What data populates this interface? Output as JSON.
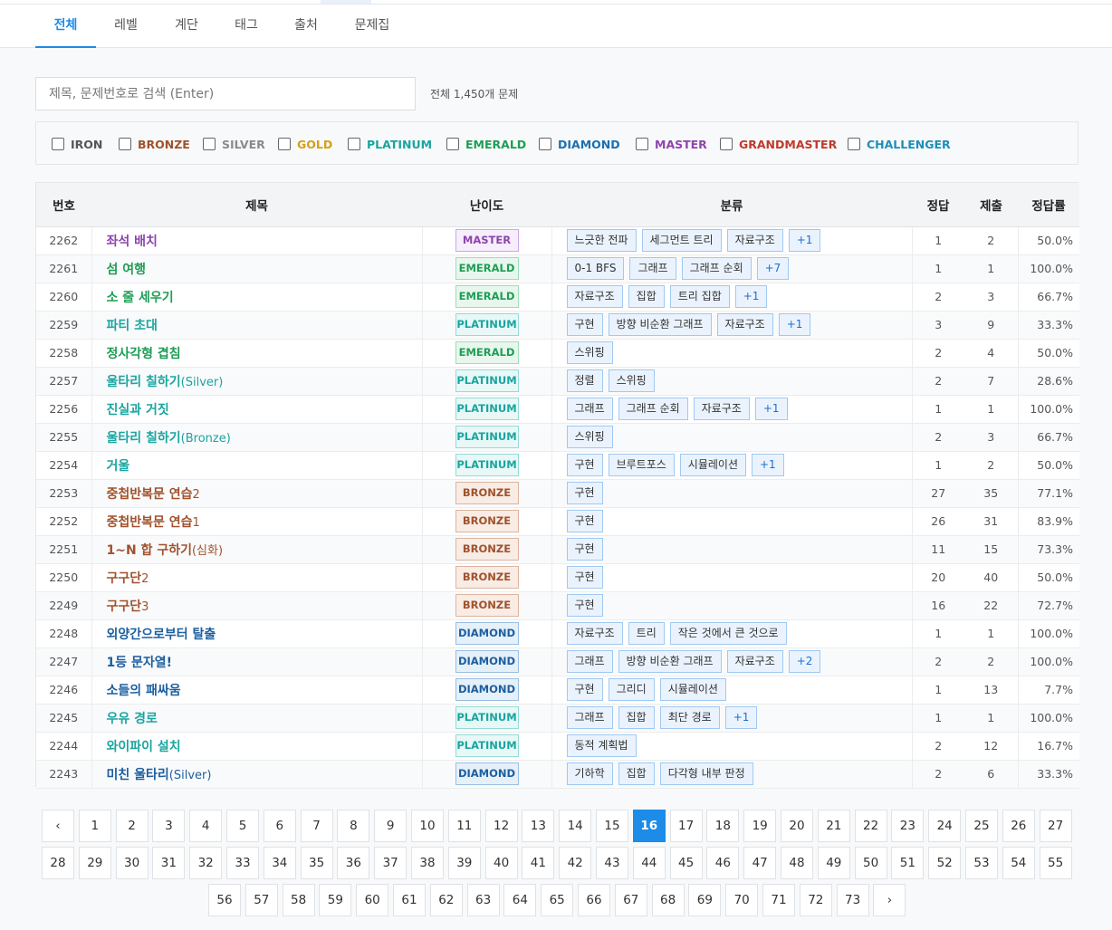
{
  "tabs": [
    {
      "label": "전체",
      "active": true
    },
    {
      "label": "레벨",
      "active": false
    },
    {
      "label": "계단",
      "active": false
    },
    {
      "label": "태그",
      "active": false
    },
    {
      "label": "출처",
      "active": false
    },
    {
      "label": "문제집",
      "active": false
    }
  ],
  "search": {
    "placeholder": "제목, 문제번호로 검색 (Enter)",
    "value": ""
  },
  "total_text": "전체 1,450개 문제",
  "filters": [
    {
      "label": "IRON",
      "color": "#555555"
    },
    {
      "label": "BRONZE",
      "color": "#a0522d"
    },
    {
      "label": "SILVER",
      "color": "#8a8a8a"
    },
    {
      "label": "GOLD",
      "color": "#d4a017"
    },
    {
      "label": "PLATINUM",
      "color": "#1aa5a0"
    },
    {
      "label": "EMERALD",
      "color": "#1e9e54"
    },
    {
      "label": "DIAMOND",
      "color": "#1c6fb0"
    },
    {
      "label": "MASTER",
      "color": "#8e44ad"
    },
    {
      "label": "GRANDMASTER",
      "color": "#c0392b"
    },
    {
      "label": "CHALLENGER",
      "color": "#1d8fb8"
    }
  ],
  "levels": {
    "MASTER": {
      "text": "#8e44ad",
      "bg": "#f6eefb",
      "border": "#cfa8e6"
    },
    "EMERALD": {
      "text": "#1e9e54",
      "bg": "#e8f7ee",
      "border": "#9fdcb7"
    },
    "PLATINUM": {
      "text": "#1aa5a0",
      "bg": "#e7f8f7",
      "border": "#94dbd7"
    },
    "BRONZE": {
      "text": "#a0522d",
      "bg": "#f8ece5",
      "border": "#deb49e"
    },
    "DIAMOND": {
      "text": "#1c5fa0",
      "bg": "#e6f0f9",
      "border": "#98bfe3"
    }
  },
  "columns": [
    "번호",
    "제목",
    "난이도",
    "분류",
    "정답",
    "제출",
    "정답률"
  ],
  "rows": [
    {
      "id": "2262",
      "title": "좌석 배치",
      "sub": "",
      "level": "MASTER",
      "tags": [
        "느긋한 전파",
        "세그먼트 트리",
        "자료구조"
      ],
      "more": "+1",
      "correct": "1",
      "submit": "2",
      "ratio": "50.0%"
    },
    {
      "id": "2261",
      "title": "섬 여행",
      "sub": "",
      "level": "EMERALD",
      "tags": [
        "0-1 BFS",
        "그래프",
        "그래프 순회"
      ],
      "more": "+7",
      "correct": "1",
      "submit": "1",
      "ratio": "100.0%"
    },
    {
      "id": "2260",
      "title": "소 줄 세우기",
      "sub": "",
      "level": "EMERALD",
      "tags": [
        "자료구조",
        "집합",
        "트리 집합"
      ],
      "more": "+1",
      "correct": "2",
      "submit": "3",
      "ratio": "66.7%"
    },
    {
      "id": "2259",
      "title": "파티 초대",
      "sub": "",
      "level": "PLATINUM",
      "tags": [
        "구현",
        "방향 비순환 그래프",
        "자료구조"
      ],
      "more": "+1",
      "correct": "3",
      "submit": "9",
      "ratio": "33.3%"
    },
    {
      "id": "2258",
      "title": "정사각형 겹침",
      "sub": "",
      "level": "EMERALD",
      "tags": [
        "스위핑"
      ],
      "more": "",
      "correct": "2",
      "submit": "4",
      "ratio": "50.0%"
    },
    {
      "id": "2257",
      "title": "울타리 칠하기",
      "sub": "(Silver)",
      "level": "PLATINUM",
      "tags": [
        "정렬",
        "스위핑"
      ],
      "more": "",
      "correct": "2",
      "submit": "7",
      "ratio": "28.6%"
    },
    {
      "id": "2256",
      "title": "진실과 거짓",
      "sub": "",
      "level": "PLATINUM",
      "tags": [
        "그래프",
        "그래프 순회",
        "자료구조"
      ],
      "more": "+1",
      "correct": "1",
      "submit": "1",
      "ratio": "100.0%"
    },
    {
      "id": "2255",
      "title": "울타리 칠하기",
      "sub": "(Bronze)",
      "level": "PLATINUM",
      "tags": [
        "스위핑"
      ],
      "more": "",
      "correct": "2",
      "submit": "3",
      "ratio": "66.7%"
    },
    {
      "id": "2254",
      "title": "거울",
      "sub": "",
      "level": "PLATINUM",
      "tags": [
        "구현",
        "브루트포스",
        "시뮬레이션"
      ],
      "more": "+1",
      "correct": "1",
      "submit": "2",
      "ratio": "50.0%"
    },
    {
      "id": "2253",
      "title": "중첩반복문 연습",
      "sub": "2",
      "level": "BRONZE",
      "tags": [
        "구현"
      ],
      "more": "",
      "correct": "27",
      "submit": "35",
      "ratio": "77.1%"
    },
    {
      "id": "2252",
      "title": "중첩반복문 연습",
      "sub": "1",
      "level": "BRONZE",
      "tags": [
        "구현"
      ],
      "more": "",
      "correct": "26",
      "submit": "31",
      "ratio": "83.9%"
    },
    {
      "id": "2251",
      "title": "1~N 합 구하기",
      "sub": "(심화)",
      "level": "BRONZE",
      "tags": [
        "구현"
      ],
      "more": "",
      "correct": "11",
      "submit": "15",
      "ratio": "73.3%"
    },
    {
      "id": "2250",
      "title": "구구단",
      "sub": "2",
      "level": "BRONZE",
      "tags": [
        "구현"
      ],
      "more": "",
      "correct": "20",
      "submit": "40",
      "ratio": "50.0%"
    },
    {
      "id": "2249",
      "title": "구구단",
      "sub": "3",
      "level": "BRONZE",
      "tags": [
        "구현"
      ],
      "more": "",
      "correct": "16",
      "submit": "22",
      "ratio": "72.7%"
    },
    {
      "id": "2248",
      "title": "외양간으로부터 탈출",
      "sub": "",
      "level": "DIAMOND",
      "tags": [
        "자료구조",
        "트리",
        "작은 것에서 큰 것으로"
      ],
      "more": "",
      "correct": "1",
      "submit": "1",
      "ratio": "100.0%"
    },
    {
      "id": "2247",
      "title": "1등 문자열!",
      "sub": "",
      "level": "DIAMOND",
      "tags": [
        "그래프",
        "방향 비순환 그래프",
        "자료구조"
      ],
      "more": "+2",
      "correct": "2",
      "submit": "2",
      "ratio": "100.0%"
    },
    {
      "id": "2246",
      "title": "소들의 패싸움",
      "sub": "",
      "level": "DIAMOND",
      "tags": [
        "구현",
        "그리디",
        "시뮬레이션"
      ],
      "more": "",
      "correct": "1",
      "submit": "13",
      "ratio": "7.7%"
    },
    {
      "id": "2245",
      "title": "우유 경로",
      "sub": "",
      "level": "PLATINUM",
      "tags": [
        "그래프",
        "집합",
        "최단 경로"
      ],
      "more": "+1",
      "correct": "1",
      "submit": "1",
      "ratio": "100.0%"
    },
    {
      "id": "2244",
      "title": "와이파이 설치",
      "sub": "",
      "level": "PLATINUM",
      "tags": [
        "동적 계획법"
      ],
      "more": "",
      "correct": "2",
      "submit": "12",
      "ratio": "16.7%"
    },
    {
      "id": "2243",
      "title": "미친 울타리",
      "sub": "(Silver)",
      "level": "DIAMOND",
      "tags": [
        "기하학",
        "집합",
        "다각형 내부 판정"
      ],
      "more": "",
      "correct": "2",
      "submit": "6",
      "ratio": "33.3%"
    }
  ],
  "pagination": {
    "prev": "‹",
    "next": "›",
    "current": "16",
    "rows": [
      [
        "‹",
        "1",
        "2",
        "3",
        "4",
        "5",
        "6",
        "7",
        "8",
        "9",
        "10",
        "11",
        "12",
        "13",
        "14",
        "15",
        "16",
        "17",
        "18",
        "19",
        "20",
        "21",
        "22",
        "23",
        "24",
        "25",
        "26",
        "27"
      ],
      [
        "28",
        "29",
        "30",
        "31",
        "32",
        "33",
        "34",
        "35",
        "36",
        "37",
        "38",
        "39",
        "40",
        "41",
        "42",
        "43",
        "44",
        "45",
        "46",
        "47",
        "48",
        "49",
        "50",
        "51",
        "52",
        "53",
        "54",
        "55"
      ],
      [
        "56",
        "57",
        "58",
        "59",
        "60",
        "61",
        "62",
        "63",
        "64",
        "65",
        "66",
        "67",
        "68",
        "69",
        "70",
        "71",
        "72",
        "73",
        "›"
      ]
    ]
  }
}
